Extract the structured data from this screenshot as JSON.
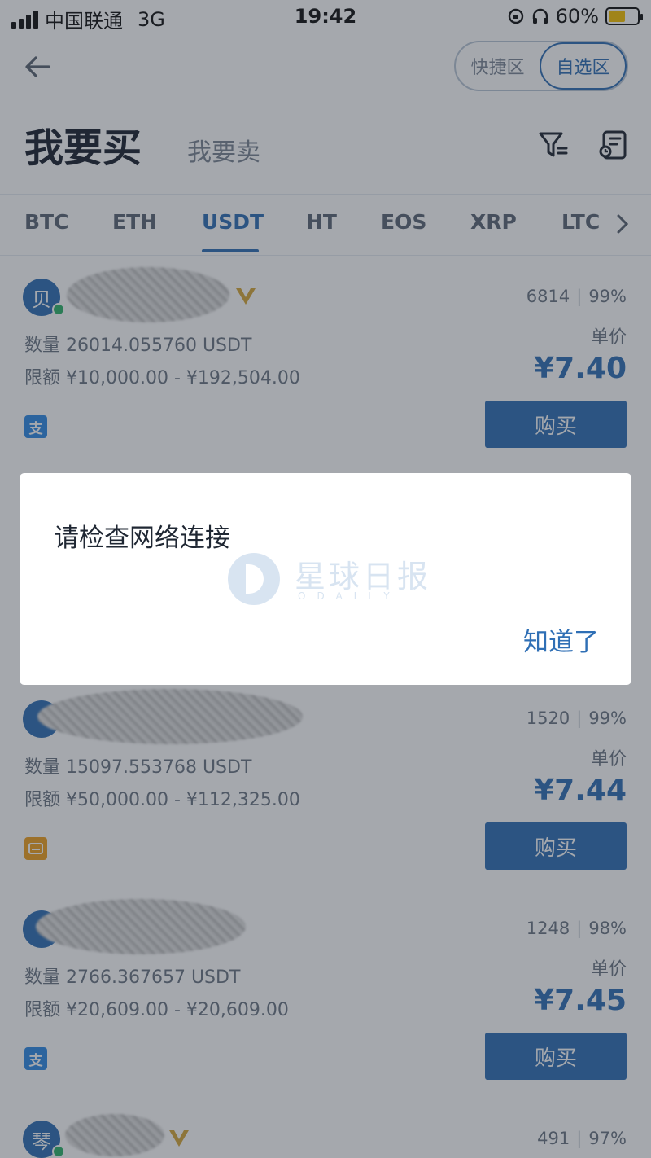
{
  "status_bar": {
    "carrier": "中国联通",
    "network": "3G",
    "time": "19:42",
    "battery": "60%"
  },
  "header": {
    "zone_quick": "快捷区",
    "zone_selected": "自选区",
    "title_buy": "我要买",
    "title_sell": "我要卖"
  },
  "tabs": [
    "BTC",
    "ETH",
    "USDT",
    "HT",
    "EOS",
    "XRP",
    "LTC"
  ],
  "listings": [
    {
      "avatar": "贝",
      "trades": "6814",
      "rate": "99%",
      "qty": "数量 26014.055760 USDT",
      "limit": "限额 ¥10,000.00 - ¥192,504.00",
      "unit_label": "单价",
      "price": "¥7.40",
      "pay_icon": "支",
      "buy_label": "购买"
    },
    {
      "avatar": "",
      "trades": "1520",
      "rate": "99%",
      "qty": "数量 15097.553768 USDT",
      "limit": "限额 ¥50,000.00 - ¥112,325.00",
      "unit_label": "单价",
      "price": "¥7.44",
      "pay_icon": "",
      "buy_label": "购买"
    },
    {
      "avatar": "",
      "trades": "1248",
      "rate": "98%",
      "qty": "数量 2766.367657 USDT",
      "limit": "限额 ¥20,609.00 - ¥20,609.00",
      "unit_label": "单价",
      "price": "¥7.45",
      "pay_icon": "支",
      "buy_label": "购买"
    },
    {
      "avatar": "琴",
      "trades": "491",
      "rate": "97%"
    }
  ],
  "dialog": {
    "message": "请检查网络连接",
    "button": "知道了",
    "watermark_text": "星球日报",
    "watermark_sub": "ODAILY"
  },
  "colors": {
    "accent": "#2f6fb5",
    "online": "#2db36a",
    "alipay": "#2f8be6",
    "bank": "#f0a020"
  }
}
